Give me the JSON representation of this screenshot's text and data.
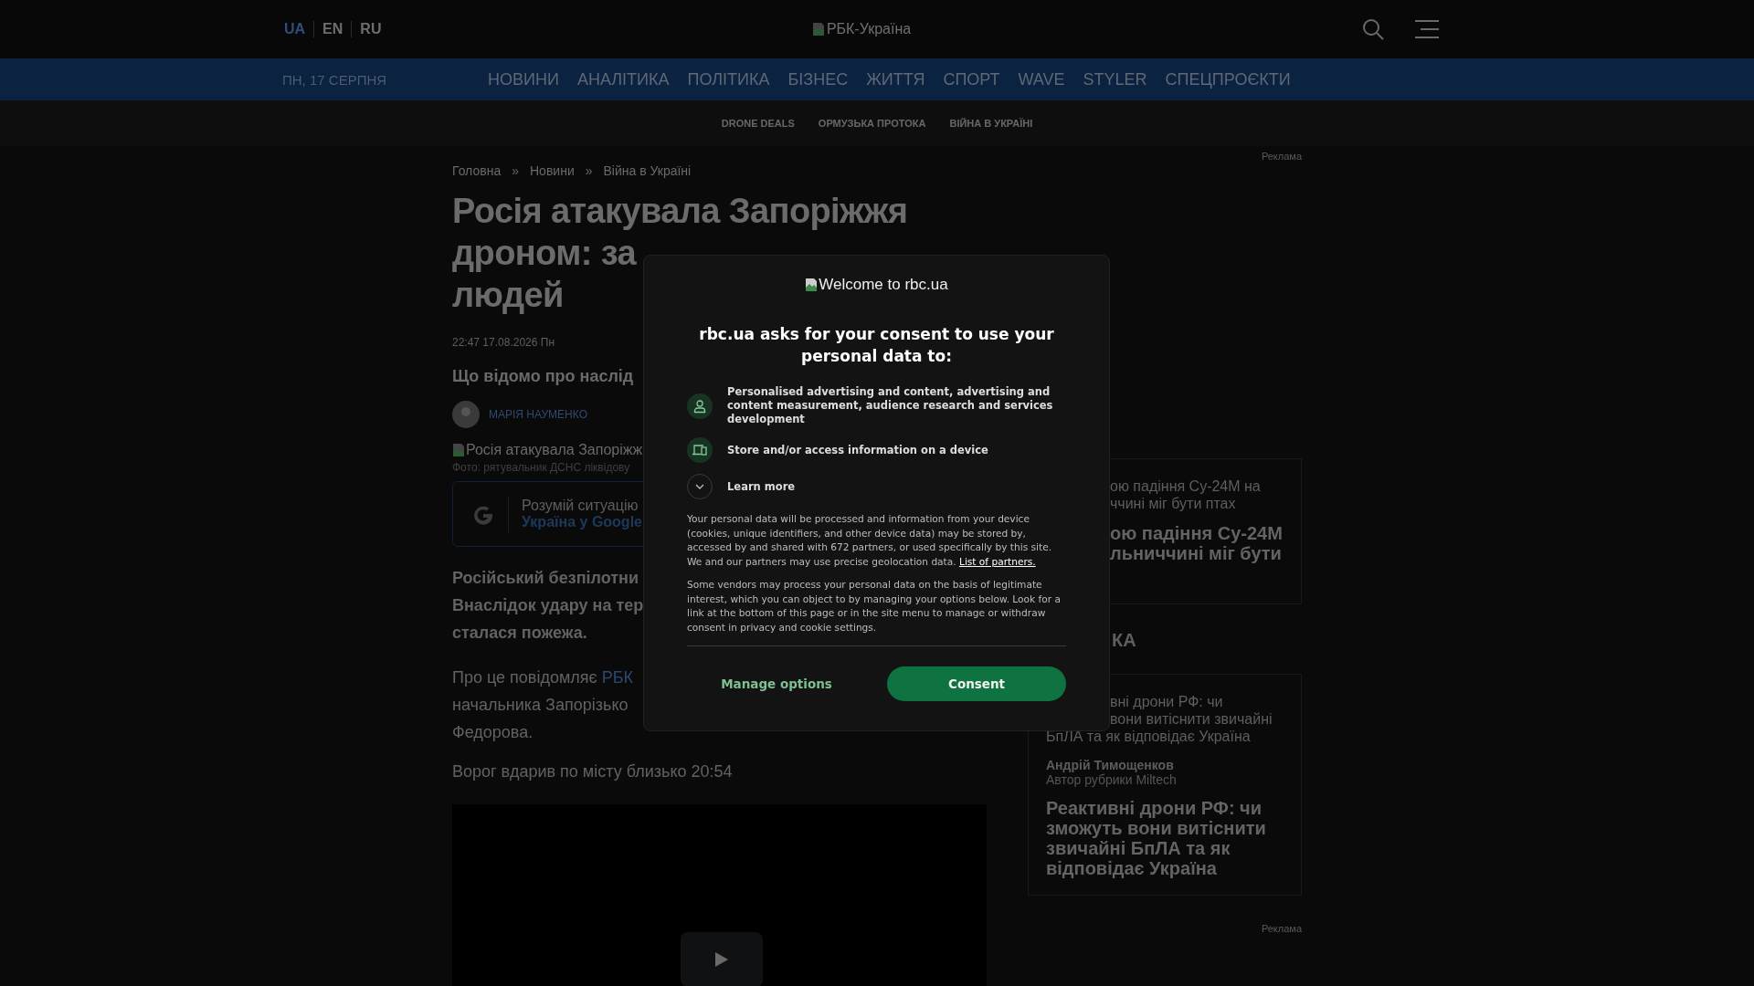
{
  "header": {
    "languages": [
      {
        "label": "UA",
        "selected": true
      },
      {
        "label": "EN",
        "selected": false
      },
      {
        "label": "RU",
        "selected": false
      }
    ],
    "logo_alt": "РБК-Україна"
  },
  "nav": {
    "date": "ПН, 17 СЕРПНЯ",
    "items": [
      "НОВИНИ",
      "АНАЛІТИКА",
      "ПОЛІТИКА",
      "БІЗНЕС",
      "ЖИТТЯ",
      "СПОРТ",
      "WAVE",
      "STYLER",
      "СПЕЦПРОЄКТИ"
    ]
  },
  "subnav": [
    "DRONE DEALS",
    "ОРМУЗЬКА ПРОТОКА",
    "ВІЙНА В УКРАЇНІ"
  ],
  "ad_labels": [
    "Реклама",
    "Реклама"
  ],
  "breadcrumbs": [
    "Головна",
    "»",
    "Новини",
    "»",
    "Війна в Україні"
  ],
  "article": {
    "title_lines": [
      "Росія атакувала Запоріжжя",
      "дроном: за",
      "людей"
    ],
    "date": "22:47 17.08.2026 Пн",
    "subtitle": "Що відомо про наслід",
    "author": "МАРІЯ НАУМЕНКО",
    "image_alt": "Росія атакувала Запоріжж",
    "caption": "Фото: рятувальник ДСНС ліквідову",
    "google_box": {
      "text": "Розумій ситуацію",
      "link": "Україна у Google"
    },
    "lead_lines": [
      "Російський безпілотни",
      "Внаслідок удару на тер",
      "сталася пожежа."
    ],
    "source_lines": [
      "Про це повідомляє",
      "начальника Запорізько",
      "Федорова."
    ],
    "source_link": "РБК",
    "paragraph": "Ворог вдарив по місту близько 20:54"
  },
  "sidebar": {
    "cards": [
      {
        "lead_lines": [
          "ою падіння Су-24М на",
          "ччині міг бути птах"
        ],
        "title_lines": [
          "ою падіння Су-24М",
          "льниччині міг бути"
        ]
      },
      {
        "lead_lines": [
          "вні дрони РФ: чи",
          "вони витіснити звичайні",
          "БпЛА та як відповідає Україна"
        ],
        "author": "Андрій Тимощенков",
        "author_role": "Автор рубрики Miltech",
        "title_lines": [
          "Реактивні дрони РФ: чи",
          "зможуть вони витіснити",
          "звичайні БпЛА та як",
          "відповідає Україна"
        ]
      }
    ],
    "section_heading": "КА"
  },
  "consent": {
    "logo_alt": "Welcome to rbc.ua",
    "heading": "rbc.ua asks for your consent to use your personal data to:",
    "purposes": [
      {
        "kind": "person",
        "text": "Personalised advertising and content, advertising and content measurement, audience research and services development"
      },
      {
        "kind": "device",
        "text": "Store and/or access information on a device"
      }
    ],
    "learn_more": {
      "label": "Learn more",
      "expanded": false
    },
    "notice": "Your personal data will be processed and information from your device (cookies, unique identifiers, and other device data) may be stored by, accessed by and shared with 672 partners, or used specifically by this site. We and our partners may use precise geolocation data.",
    "partners_link": "List of partners.",
    "vendors_notice": "Some vendors may process your personal data on the basis of legitimate interest, which you can object to by managing your options below. Look for a link at the bottom of this page or in the site menu to manage or withdraw consent in privacy and cookie settings.",
    "buttons": [
      "Manage options",
      "Consent"
    ]
  }
}
